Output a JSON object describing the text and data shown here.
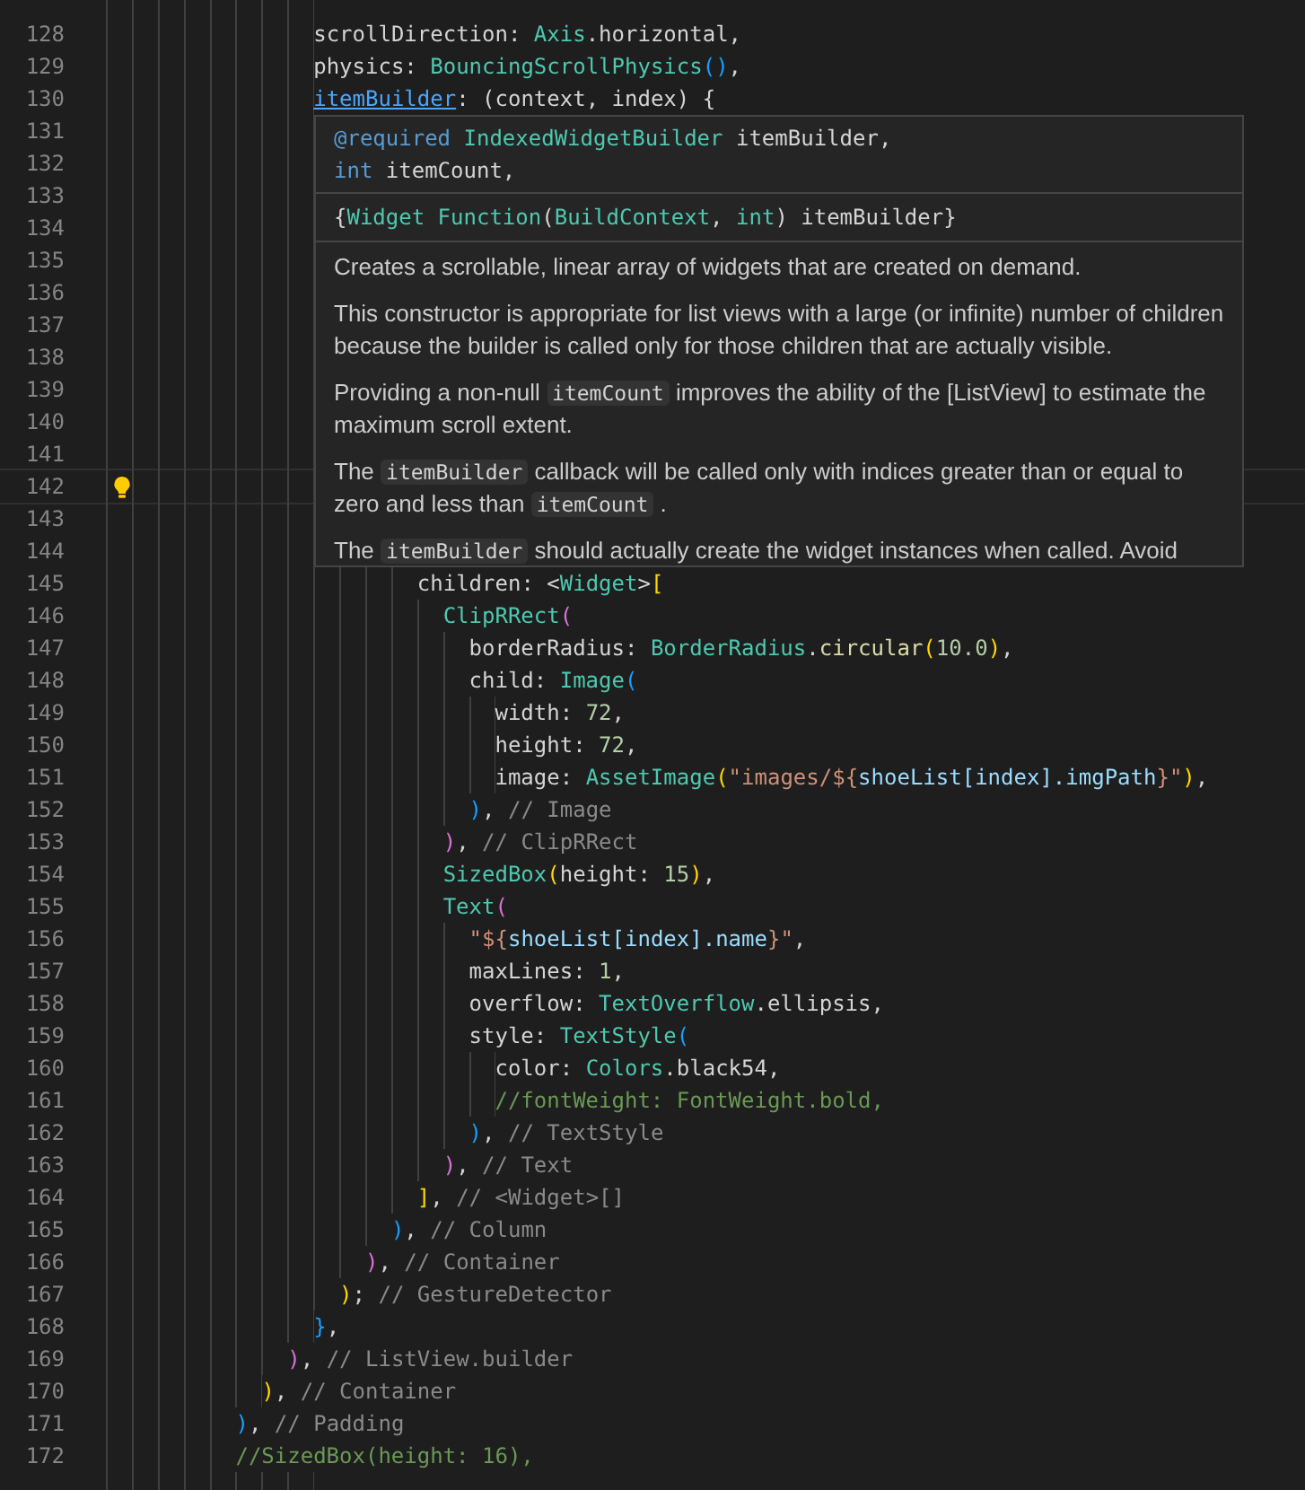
{
  "editor": {
    "lines": [
      {
        "current": false
      },
      {
        "number": "128",
        "current": false,
        "tokens": [
          {
            "text": "                scrollDirection: ",
            "kind": "plain"
          },
          {
            "text": "Axis",
            "kind": "type"
          },
          {
            "text": ".horizontal,",
            "kind": "plain"
          }
        ]
      },
      {
        "number": "129",
        "current": false,
        "tokens": [
          {
            "text": "                physics: ",
            "kind": "plain"
          },
          {
            "text": "BouncingScrollPhysics",
            "kind": "type"
          },
          {
            "text": "()",
            "kind": "bracket3"
          },
          {
            "text": ",",
            "kind": "plain"
          }
        ]
      },
      {
        "number": "130",
        "current": false,
        "tokens": [
          {
            "text": "                itemBuilder",
            "kind": "link"
          },
          {
            "text": ": (context, index) {",
            "kind": "plain"
          }
        ]
      },
      {
        "number": "131",
        "current": false
      },
      {
        "number": "132",
        "current": false
      },
      {
        "number": "133",
        "current": false
      },
      {
        "number": "134",
        "current": false
      },
      {
        "number": "135",
        "current": false
      },
      {
        "number": "136",
        "current": false
      },
      {
        "number": "137",
        "current": false
      },
      {
        "number": "138",
        "current": false
      },
      {
        "number": "139",
        "current": false
      },
      {
        "number": "140",
        "current": false
      },
      {
        "number": "141",
        "current": false
      },
      {
        "number": "142",
        "current": true
      },
      {
        "number": "143",
        "current": false
      },
      {
        "number": "144",
        "current": false
      },
      {
        "number": "145",
        "current": false,
        "tokens": [
          {
            "text": "                        children: <",
            "kind": "plain"
          },
          {
            "text": "Widget",
            "kind": "type"
          },
          {
            "text": ">",
            "kind": "plain"
          },
          {
            "text": "[",
            "kind": "bracket1"
          }
        ]
      },
      {
        "number": "146",
        "current": false,
        "tokens": [
          {
            "text": "                          ClipRRect",
            "kind": "type"
          },
          {
            "text": "(",
            "kind": "bracket2"
          }
        ]
      },
      {
        "number": "147",
        "current": false,
        "tokens": [
          {
            "text": "                            borderRadius: ",
            "kind": "plain"
          },
          {
            "text": "BorderRadius",
            "kind": "type"
          },
          {
            "text": ".",
            "kind": "plain"
          },
          {
            "text": "circular",
            "kind": "function"
          },
          {
            "text": "(",
            "kind": "bracket1"
          },
          {
            "text": "10.0",
            "kind": "number"
          },
          {
            "text": ")",
            "kind": "bracket1"
          },
          {
            "text": ",",
            "kind": "plain"
          }
        ]
      },
      {
        "number": "148",
        "current": false,
        "tokens": [
          {
            "text": "                            child: ",
            "kind": "plain"
          },
          {
            "text": "Image",
            "kind": "type"
          },
          {
            "text": "(",
            "kind": "bracket3"
          }
        ]
      },
      {
        "number": "149",
        "current": false,
        "tokens": [
          {
            "text": "                              width: ",
            "kind": "plain"
          },
          {
            "text": "72",
            "kind": "number"
          },
          {
            "text": ",",
            "kind": "plain"
          }
        ]
      },
      {
        "number": "150",
        "current": false,
        "tokens": [
          {
            "text": "                              height: ",
            "kind": "plain"
          },
          {
            "text": "72",
            "kind": "number"
          },
          {
            "text": ",",
            "kind": "plain"
          }
        ]
      },
      {
        "number": "151",
        "current": false,
        "tokens": [
          {
            "text": "                              image: ",
            "kind": "plain"
          },
          {
            "text": "AssetImage",
            "kind": "type"
          },
          {
            "text": "(",
            "kind": "bracket1"
          },
          {
            "text": "\"images/${",
            "kind": "string"
          },
          {
            "text": "shoeList[index].imgPath",
            "kind": "variable"
          },
          {
            "text": "}\"",
            "kind": "string"
          },
          {
            "text": ")",
            "kind": "bracket1"
          },
          {
            "text": ",",
            "kind": "plain"
          }
        ]
      },
      {
        "number": "152",
        "current": false,
        "tokens": [
          {
            "text": "                            )",
            "kind": "bracket3"
          },
          {
            "text": ", ",
            "kind": "plain"
          },
          {
            "text": "// Image",
            "kind": "label"
          }
        ]
      },
      {
        "number": "153",
        "current": false,
        "tokens": [
          {
            "text": "                          )",
            "kind": "bracket2"
          },
          {
            "text": ", ",
            "kind": "plain"
          },
          {
            "text": "// ClipRRect",
            "kind": "label"
          }
        ]
      },
      {
        "number": "154",
        "current": false,
        "tokens": [
          {
            "text": "                          SizedBox",
            "kind": "type"
          },
          {
            "text": "(",
            "kind": "bracket1"
          },
          {
            "text": "height: ",
            "kind": "plain"
          },
          {
            "text": "15",
            "kind": "number"
          },
          {
            "text": ")",
            "kind": "bracket1"
          },
          {
            "text": ",",
            "kind": "plain"
          }
        ]
      },
      {
        "number": "155",
        "current": false,
        "tokens": [
          {
            "text": "                          Text",
            "kind": "type"
          },
          {
            "text": "(",
            "kind": "bracket2"
          }
        ]
      },
      {
        "number": "156",
        "current": false,
        "tokens": [
          {
            "text": "                            \"${",
            "kind": "string"
          },
          {
            "text": "shoeList[index].name",
            "kind": "variable"
          },
          {
            "text": "}\"",
            "kind": "string"
          },
          {
            "text": ",",
            "kind": "plain"
          }
        ]
      },
      {
        "number": "157",
        "current": false,
        "tokens": [
          {
            "text": "                            maxLines: ",
            "kind": "plain"
          },
          {
            "text": "1",
            "kind": "number"
          },
          {
            "text": ",",
            "kind": "plain"
          }
        ]
      },
      {
        "number": "158",
        "current": false,
        "tokens": [
          {
            "text": "                            overflow: ",
            "kind": "plain"
          },
          {
            "text": "TextOverflow",
            "kind": "type"
          },
          {
            "text": ".ellipsis,",
            "kind": "plain"
          }
        ]
      },
      {
        "number": "159",
        "current": false,
        "tokens": [
          {
            "text": "                            style: ",
            "kind": "plain"
          },
          {
            "text": "TextStyle",
            "kind": "type"
          },
          {
            "text": "(",
            "kind": "bracket3"
          }
        ]
      },
      {
        "number": "160",
        "current": false,
        "tokens": [
          {
            "text": "                              color: ",
            "kind": "plain"
          },
          {
            "text": "Colors",
            "kind": "type"
          },
          {
            "text": ".black54,",
            "kind": "plain"
          }
        ]
      },
      {
        "number": "161",
        "current": false,
        "tokens": [
          {
            "text": "                              //fontWeight: FontWeight.bold,",
            "kind": "comment"
          }
        ]
      },
      {
        "number": "162",
        "current": false,
        "tokens": [
          {
            "text": "                            )",
            "kind": "bracket3"
          },
          {
            "text": ", ",
            "kind": "plain"
          },
          {
            "text": "// TextStyle",
            "kind": "label"
          }
        ]
      },
      {
        "number": "163",
        "current": false,
        "tokens": [
          {
            "text": "                          )",
            "kind": "bracket2"
          },
          {
            "text": ", ",
            "kind": "plain"
          },
          {
            "text": "// Text",
            "kind": "label"
          }
        ]
      },
      {
        "number": "164",
        "current": false,
        "tokens": [
          {
            "text": "                        ]",
            "kind": "bracket1"
          },
          {
            "text": ", ",
            "kind": "plain"
          },
          {
            "text": "// <Widget>[]",
            "kind": "label"
          }
        ]
      },
      {
        "number": "165",
        "current": false,
        "tokens": [
          {
            "text": "                      )",
            "kind": "bracket3"
          },
          {
            "text": ", ",
            "kind": "plain"
          },
          {
            "text": "// Column",
            "kind": "label"
          }
        ]
      },
      {
        "number": "166",
        "current": false,
        "tokens": [
          {
            "text": "                    )",
            "kind": "bracket2"
          },
          {
            "text": ", ",
            "kind": "plain"
          },
          {
            "text": "// Container",
            "kind": "label"
          }
        ]
      },
      {
        "number": "167",
        "current": false,
        "tokens": [
          {
            "text": "                  )",
            "kind": "bracket1"
          },
          {
            "text": "; ",
            "kind": "plain"
          },
          {
            "text": "// GestureDetector",
            "kind": "label"
          }
        ]
      },
      {
        "number": "168",
        "current": false,
        "tokens": [
          {
            "text": "                }",
            "kind": "bracket3"
          },
          {
            "text": ",",
            "kind": "plain"
          }
        ]
      },
      {
        "number": "169",
        "current": false,
        "tokens": [
          {
            "text": "              )",
            "kind": "bracket2"
          },
          {
            "text": ", ",
            "kind": "plain"
          },
          {
            "text": "// ListView.builder",
            "kind": "label"
          }
        ]
      },
      {
        "number": "170",
        "current": false,
        "tokens": [
          {
            "text": "            )",
            "kind": "bracket1"
          },
          {
            "text": ", ",
            "kind": "plain"
          },
          {
            "text": "// Container",
            "kind": "label"
          }
        ]
      },
      {
        "number": "171",
        "current": false,
        "tokens": [
          {
            "text": "          )",
            "kind": "bracket3"
          },
          {
            "text": ", ",
            "kind": "plain"
          },
          {
            "text": "// Padding",
            "kind": "label"
          }
        ]
      },
      {
        "number": "172",
        "current": false,
        "tokens": [
          {
            "text": "          //SizedBox(height: 16),",
            "kind": "comment"
          }
        ]
      },
      {
        "current": false
      }
    ]
  },
  "hover_tooltip": {
    "signature_lines": [
      [
        {
          "text": "@required",
          "kind": "keyword"
        },
        {
          "text": " IndexedWidgetBuilder",
          "kind": "type"
        },
        {
          "text": " itemBuilder,",
          "kind": "plain"
        }
      ],
      [
        {
          "text": "int",
          "kind": "keyword"
        },
        {
          "text": " itemCount,",
          "kind": "plain"
        }
      ]
    ],
    "type_line": [
      {
        "text": "{",
        "kind": "plain"
      },
      {
        "text": "Widget Function",
        "kind": "type"
      },
      {
        "text": "(",
        "kind": "plain"
      },
      {
        "text": "BuildContext",
        "kind": "type"
      },
      {
        "text": ", ",
        "kind": "plain"
      },
      {
        "text": "int",
        "kind": "type"
      },
      {
        "text": ") itemBuilder}",
        "kind": "plain"
      }
    ],
    "paragraphs": [
      [
        {
          "text": "Creates a scrollable, linear array of widgets that are created on demand.",
          "code": false
        }
      ],
      [
        {
          "text": "This constructor is appropriate for list views with a large (or infinite) number of children because the builder is called only for those children that are actually visible.",
          "code": false
        }
      ],
      [
        {
          "text": "Providing a non-null ",
          "code": false
        },
        {
          "text": "itemCount",
          "code": true
        },
        {
          "text": " improves the ability of the [ListView] to estimate the maximum scroll extent.",
          "code": false
        }
      ],
      [
        {
          "text": "The ",
          "code": false
        },
        {
          "text": "itemBuilder",
          "code": true
        },
        {
          "text": " callback will be called only with indices greater than or equal to zero and less than ",
          "code": false
        },
        {
          "text": "itemCount",
          "code": true
        },
        {
          "text": " .",
          "code": false
        }
      ],
      [
        {
          "text": "The ",
          "code": false
        },
        {
          "text": "itemBuilder",
          "code": true
        },
        {
          "text": " should actually create the widget instances when called. Avoid",
          "code": false
        }
      ]
    ]
  }
}
